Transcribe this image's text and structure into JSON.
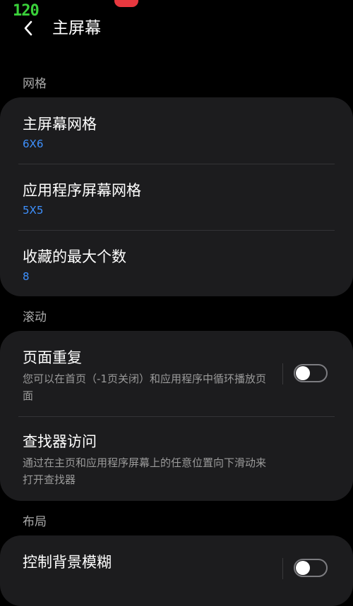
{
  "status": {
    "fps": "120"
  },
  "header": {
    "title": "主屏幕",
    "back_icon": "chevron-left-icon"
  },
  "sections": {
    "grid": {
      "label": "网格",
      "items": [
        {
          "title": "主屏幕网格",
          "value": "6X6"
        },
        {
          "title": "应用程序屏幕网格",
          "value": "5X5"
        },
        {
          "title": "收藏的最大个数",
          "value": "8"
        }
      ]
    },
    "scroll": {
      "label": "滚动",
      "items": [
        {
          "title": "页面重复",
          "desc": "您可以在首页（-1页关闭）和应用程序中循环播放页面",
          "toggle": false
        },
        {
          "title": "查找器访问",
          "desc": "通过在主页和应用程序屏幕上的任意位置向下滑动来打开查找器"
        }
      ]
    },
    "layout": {
      "label": "布局",
      "items": [
        {
          "title": "控制背景模糊",
          "toggle": false
        }
      ]
    }
  },
  "colors": {
    "background": "#000000",
    "card": "#1c1c1e",
    "accent": "#3e91ff",
    "fps": "#3ad13a",
    "recording": "#e8383f"
  }
}
